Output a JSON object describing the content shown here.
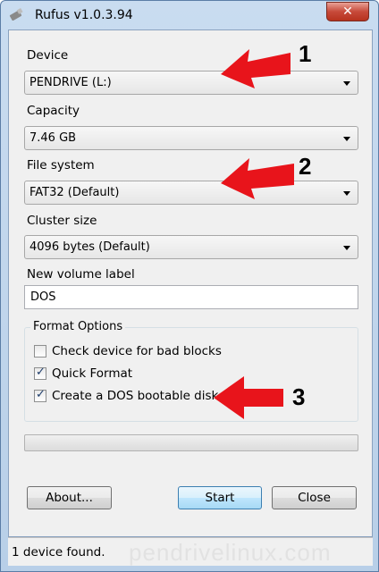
{
  "window": {
    "title": "Rufus v1.0.3.94",
    "close_glyph": "✕"
  },
  "device": {
    "label": "Device",
    "value": "PENDRIVE (L:)"
  },
  "capacity": {
    "label": "Capacity",
    "value": "7.46 GB"
  },
  "file_system": {
    "label": "File system",
    "value": "FAT32 (Default)"
  },
  "cluster_size": {
    "label": "Cluster size",
    "value": "4096 bytes (Default)"
  },
  "volume_label": {
    "label": "New volume label",
    "value": "DOS"
  },
  "format_options": {
    "title": "Format Options",
    "items": [
      {
        "label": "Check device for bad blocks",
        "checked": false
      },
      {
        "label": "Quick Format",
        "checked": true
      },
      {
        "label": "Create a DOS bootable disk",
        "checked": true
      }
    ]
  },
  "progress": {
    "value": 0
  },
  "buttons": {
    "about": "About...",
    "start": "Start",
    "close": "Close"
  },
  "status": {
    "text": "1 device found.",
    "watermark": "pendrivelinux.com"
  },
  "annotations": {
    "n1": "1",
    "n2": "2",
    "n3": "3",
    "arrow_color": "#e8141b"
  },
  "icons": {
    "app": "usb-drive-icon",
    "close": "close-icon",
    "dropdown": "chevron-down-icon",
    "check": "checkmark-icon"
  }
}
